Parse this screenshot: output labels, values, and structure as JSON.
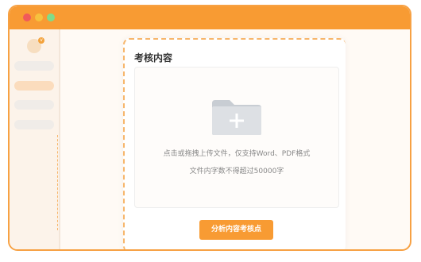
{
  "window": {
    "controls": [
      "close",
      "minimize",
      "maximize"
    ],
    "accent_color": "#f89b33"
  },
  "sidebar": {
    "avatar_badge": "v",
    "items_count": 4
  },
  "card": {
    "title": "考核内容",
    "dropzone": {
      "icon": "folder-plus-icon",
      "hint_line1": "点击或拖拽上传文件，仅支持Word、PDF格式",
      "hint_line2": "文件内字数不得超过50000字"
    },
    "analyze_button": "分析内容考核点"
  }
}
